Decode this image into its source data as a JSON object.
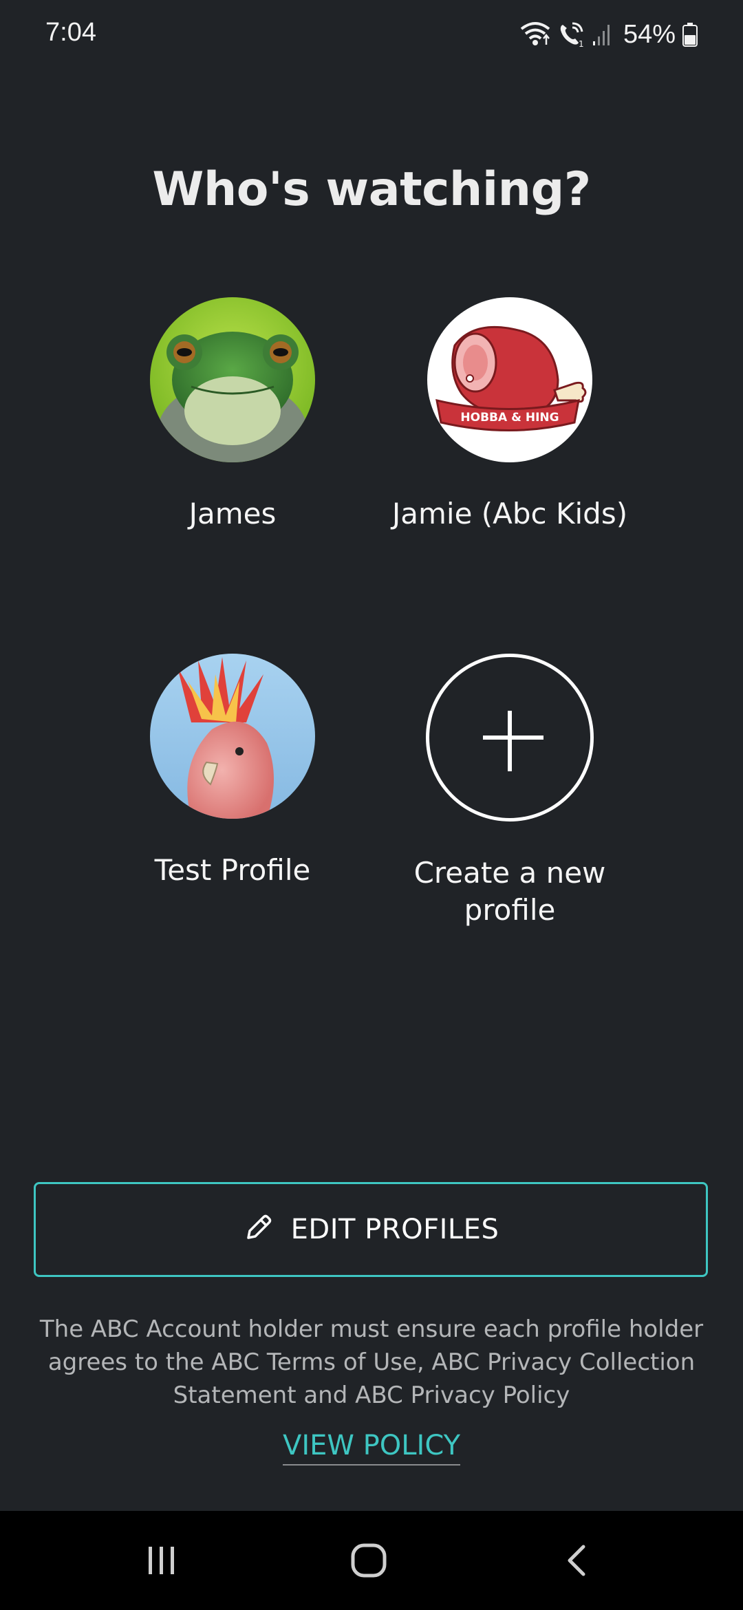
{
  "status_bar": {
    "time": "7:04",
    "battery": "54%",
    "icons": [
      "wifi-icon",
      "wifi-calling-icon",
      "signal-icon",
      "battery-icon"
    ]
  },
  "title": "Who's watching?",
  "profiles": [
    {
      "name": "James",
      "avatar": "frog-avatar"
    },
    {
      "name": "Jamie (Abc Kids)",
      "avatar": "ham-avatar",
      "avatar_text": "HOBBA & HING"
    },
    {
      "name": "Test Profile",
      "avatar": "cockatoo-avatar"
    }
  ],
  "create_profile": {
    "label": "Create a new profile",
    "icon": "plus-icon"
  },
  "edit_button": {
    "label": "EDIT PROFILES",
    "icon": "pencil-icon"
  },
  "disclaimer": "The ABC Account holder must ensure each profile holder agrees to the ABC Terms of Use, ABC Privacy Collection Statement and ABC Privacy Policy",
  "view_policy": "VIEW POLICY",
  "nav": [
    "recent-apps-icon",
    "home-icon",
    "back-icon"
  ],
  "colors": {
    "background": "#202327",
    "accent": "#3ec6c2"
  }
}
